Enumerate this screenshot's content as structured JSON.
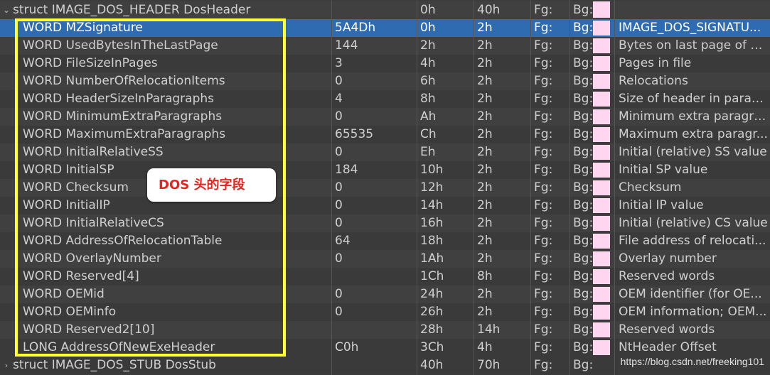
{
  "header_row": {
    "name": "struct IMAGE_DOS_HEADER DosHeader",
    "value": "",
    "start": "0h",
    "size": "40h",
    "fg": "Fg:",
    "bg": "Bg:",
    "comment": ""
  },
  "rows": [
    {
      "name": "WORD MZSignature",
      "value": "5A4Dh",
      "start": "0h",
      "size": "2h",
      "fg": "Fg:",
      "bg": "Bg:",
      "comment": "IMAGE_DOS_SIGNATU..."
    },
    {
      "name": "WORD UsedBytesInTheLastPage",
      "value": "144",
      "start": "2h",
      "size": "2h",
      "fg": "Fg:",
      "bg": "Bg:",
      "comment": "Bytes on last page of file"
    },
    {
      "name": "WORD FileSizeInPages",
      "value": "3",
      "start": "4h",
      "size": "2h",
      "fg": "Fg:",
      "bg": "Bg:",
      "comment": "Pages in file"
    },
    {
      "name": "WORD NumberOfRelocationItems",
      "value": "0",
      "start": "6h",
      "size": "2h",
      "fg": "Fg:",
      "bg": "Bg:",
      "comment": "Relocations"
    },
    {
      "name": "WORD HeaderSizeInParagraphs",
      "value": "4",
      "start": "8h",
      "size": "2h",
      "fg": "Fg:",
      "bg": "Bg:",
      "comment": "Size of header in parag..."
    },
    {
      "name": "WORD MinimumExtraParagraphs",
      "value": "0",
      "start": "Ah",
      "size": "2h",
      "fg": "Fg:",
      "bg": "Bg:",
      "comment": "Minimum extra paragra..."
    },
    {
      "name": "WORD MaximumExtraParagraphs",
      "value": "65535",
      "start": "Ch",
      "size": "2h",
      "fg": "Fg:",
      "bg": "Bg:",
      "comment": "Maximum extra paragr..."
    },
    {
      "name": "WORD InitialRelativeSS",
      "value": "0",
      "start": "Eh",
      "size": "2h",
      "fg": "Fg:",
      "bg": "Bg:",
      "comment": "Initial (relative) SS value"
    },
    {
      "name": "WORD InitialSP",
      "value": "184",
      "start": "10h",
      "size": "2h",
      "fg": "Fg:",
      "bg": "Bg:",
      "comment": "Initial SP value"
    },
    {
      "name": "WORD Checksum",
      "value": "0",
      "start": "12h",
      "size": "2h",
      "fg": "Fg:",
      "bg": "Bg:",
      "comment": "Checksum"
    },
    {
      "name": "WORD InitialIP",
      "value": "0",
      "start": "14h",
      "size": "2h",
      "fg": "Fg:",
      "bg": "Bg:",
      "comment": "Initial IP value"
    },
    {
      "name": "WORD InitialRelativeCS",
      "value": "0",
      "start": "16h",
      "size": "2h",
      "fg": "Fg:",
      "bg": "Bg:",
      "comment": "Initial (relative) CS value"
    },
    {
      "name": "WORD AddressOfRelocationTable",
      "value": "64",
      "start": "18h",
      "size": "2h",
      "fg": "Fg:",
      "bg": "Bg:",
      "comment": "File address of relocati..."
    },
    {
      "name": "WORD OverlayNumber",
      "value": "0",
      "start": "1Ah",
      "size": "2h",
      "fg": "Fg:",
      "bg": "Bg:",
      "comment": "Overlay number"
    },
    {
      "name": "WORD Reserved[4]",
      "value": "",
      "start": "1Ch",
      "size": "8h",
      "fg": "Fg:",
      "bg": "Bg:",
      "comment": "Reserved words"
    },
    {
      "name": "WORD OEMid",
      "value": "0",
      "start": "24h",
      "size": "2h",
      "fg": "Fg:",
      "bg": "Bg:",
      "comment": "OEM identifier (for OE..."
    },
    {
      "name": "WORD OEMinfo",
      "value": "0",
      "start": "26h",
      "size": "2h",
      "fg": "Fg:",
      "bg": "Bg:",
      "comment": "OEM information; OEM..."
    },
    {
      "name": "WORD Reserved2[10]",
      "value": "",
      "start": "28h",
      "size": "14h",
      "fg": "Fg:",
      "bg": "Bg:",
      "comment": "Reserved words"
    },
    {
      "name": "LONG AddressOfNewExeHeader",
      "value": "C0h",
      "start": "3Ch",
      "size": "4h",
      "fg": "Fg:",
      "bg": "Bg:",
      "comment": "NtHeader Offset"
    }
  ],
  "footer_row": {
    "name": "struct IMAGE_DOS_STUB DosStub",
    "value": "",
    "start": "40h",
    "size": "70h",
    "fg": "Fg:",
    "bg": "Bg:",
    "comment": ""
  },
  "selected_index": 0,
  "callout_text": "DOS 头的字段",
  "watermark": "https://blog.csdn.net/freeking101",
  "colors": {
    "selection": "#2e6bb0",
    "highlight_box": "#ffff33",
    "callout_text": "#e8231e",
    "bg_swatch": "#ffd6ef"
  }
}
